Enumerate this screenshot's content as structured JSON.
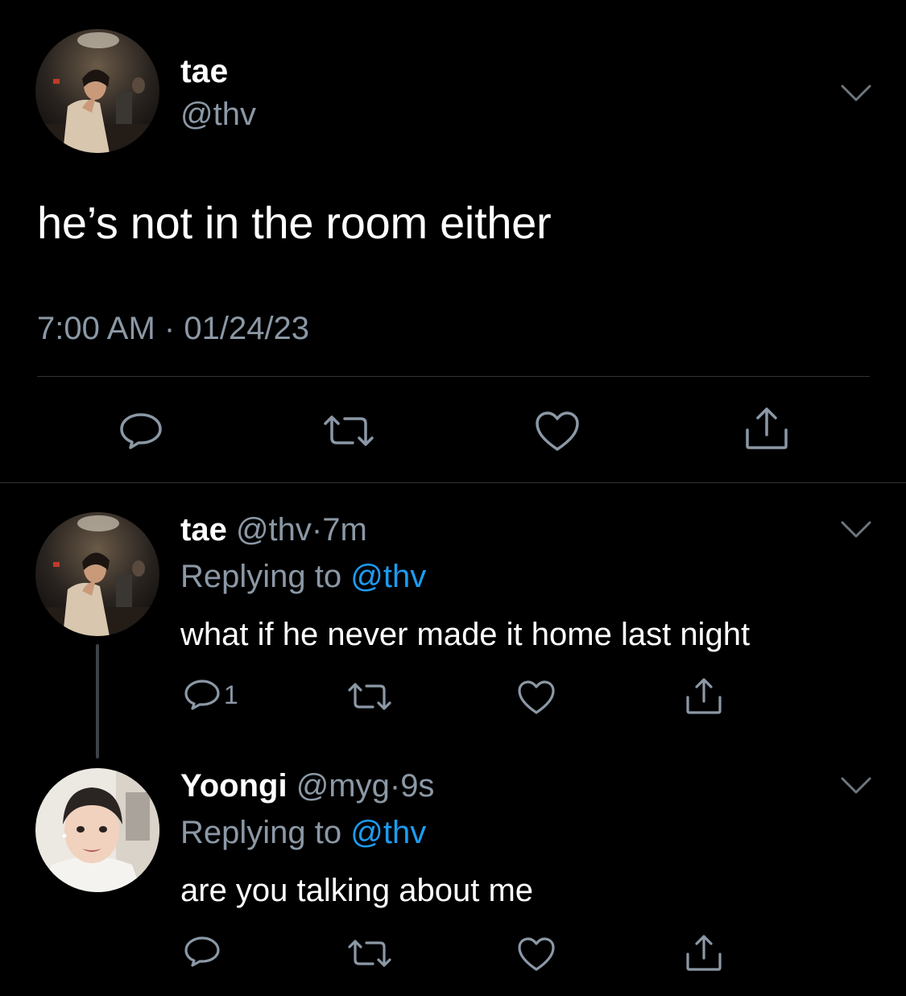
{
  "main_tweet": {
    "name": "tae",
    "handle": "@thv",
    "text": "he’s not in the room either",
    "time": "7:00 AM",
    "separator": "·",
    "date": "01/24/23"
  },
  "replies": [
    {
      "name": "tae",
      "handle": "@thv",
      "dot": "·",
      "age": "7m",
      "replying_prefix": "Replying to",
      "replying_to": "@thv",
      "text": "what if he never made it home last night",
      "reply_count": "1"
    },
    {
      "name": "Yoongi",
      "handle": "@myg",
      "dot": "·",
      "age": "9s",
      "replying_prefix": "Replying to",
      "replying_to": "@thv",
      "text": "are you talking about me"
    }
  ],
  "icons": {
    "reply": "speech-bubble-icon",
    "retweet": "retweet-icon",
    "like": "heart-icon",
    "share": "share-icon",
    "more": "chevron-down-icon"
  },
  "colors": {
    "background": "#000000",
    "text": "#ffffff",
    "secondary": "#8b98a5",
    "mention": "#1d9bf0",
    "divider": "#2f3336"
  }
}
